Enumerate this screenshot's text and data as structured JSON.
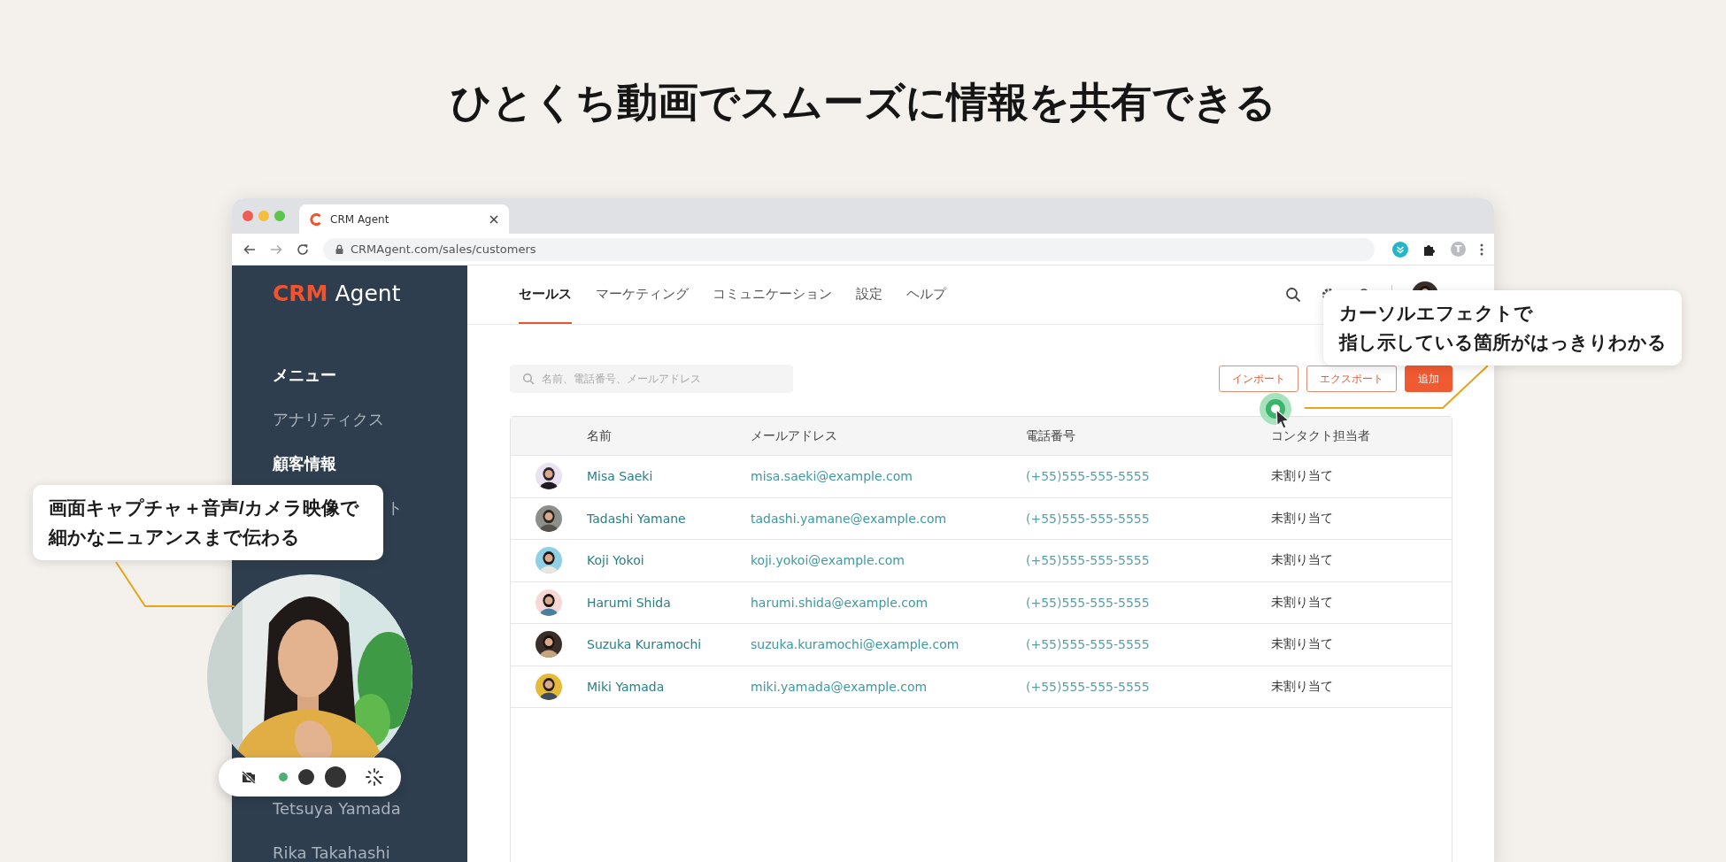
{
  "headline": "ひとくち動画でスムーズに情報を共有できる",
  "browser": {
    "tab_title": "CRM Agent",
    "url": "CRMAgent.com/sales/customers",
    "profile_initial": "T"
  },
  "sidebar": {
    "logo": "**CRM** Agent",
    "menu_heading": "メニュー",
    "items": [
      {
        "label": "アナリティクス",
        "kind": "link",
        "selected": false
      },
      {
        "label": "顧客情報",
        "kind": "link",
        "selected": true
      },
      {
        "label": "ト",
        "kind": "covered",
        "selected": false
      }
    ],
    "members": [
      {
        "label": "Tetsuya Yamada",
        "selected": false
      },
      {
        "label": "Rika Takahashi",
        "selected": false
      }
    ]
  },
  "nav": {
    "tabs": [
      {
        "label": "セールス",
        "selected": true
      },
      {
        "label": "マーケティング",
        "selected": false
      },
      {
        "label": "コミュニケーション",
        "selected": false
      },
      {
        "label": "設定",
        "selected": false
      },
      {
        "label": "ヘルプ",
        "selected": false
      }
    ]
  },
  "search": {
    "placeholder": "名前、電話番号、メールアドレス"
  },
  "actions": [
    {
      "label": "インポート",
      "kind": "outline"
    },
    {
      "label": "エクスポート",
      "kind": "outline"
    },
    {
      "label": "追加",
      "kind": "primary"
    }
  ],
  "table": {
    "columns": [
      "名前",
      "メールアドレス",
      "電話番号",
      "コンタクト担当者"
    ],
    "rows": [
      {
        "name": "Misa Saeki",
        "email": "misa.saeki@example.com",
        "phone": "(+55)555-555-5555",
        "contact": "未割り当て"
      },
      {
        "name": "Tadashi Yamane",
        "email": "tadashi.yamane@example.com",
        "phone": "(+55)555-555-5555",
        "contact": "未割り当て"
      },
      {
        "name": "Koji Yokoi",
        "email": "koji.yokoi@example.com",
        "phone": "(+55)555-555-5555",
        "contact": "未割り当て"
      },
      {
        "name": "Harumi Shida",
        "email": "harumi.shida@example.com",
        "phone": "(+55)555-555-5555",
        "contact": "未割り当て"
      },
      {
        "name": "Suzuka Kuramochi",
        "email": "suzuka.kuramochi@example.com",
        "phone": "(+55)555-555-5555",
        "contact": "未割り当て"
      },
      {
        "name": "Miki Yamada",
        "email": "miki.yamada@example.com",
        "phone": "(+55)555-555-5555",
        "contact": "未割り当て"
      }
    ]
  },
  "callouts": [
    {
      "lines": [
        "カーソルエフェクトで",
        "指し示している箇所がはっきりわかる"
      ]
    },
    {
      "lines": [
        "画面キャプチャ＋音声/カメラ映像で",
        "細かなニュアンスまで伝わる"
      ]
    }
  ],
  "camera": {
    "sizes": [
      {
        "selected": true
      },
      {
        "selected": false
      },
      {
        "selected": false
      }
    ]
  }
}
